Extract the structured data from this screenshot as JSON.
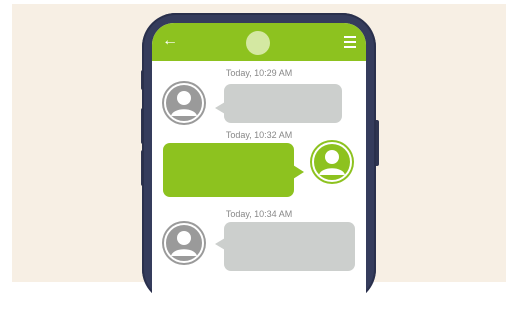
{
  "header": {
    "back_icon": "arrow-left-icon",
    "menu_icon": "hamburger-menu-icon"
  },
  "messages": [
    {
      "timestamp": "Today, 10:29 AM",
      "side": "received"
    },
    {
      "timestamp": "Today, 10:32 AM",
      "side": "sent"
    },
    {
      "timestamp": "Today, 10:34 AM",
      "side": "received"
    }
  ],
  "colors": {
    "background": "#f7efe4",
    "phone_frame": "#353c5c",
    "header": "#8dc21f",
    "sent_bubble": "#8dc21f",
    "received_bubble": "#cccfcd",
    "received_avatar": "#9a9a9a"
  }
}
